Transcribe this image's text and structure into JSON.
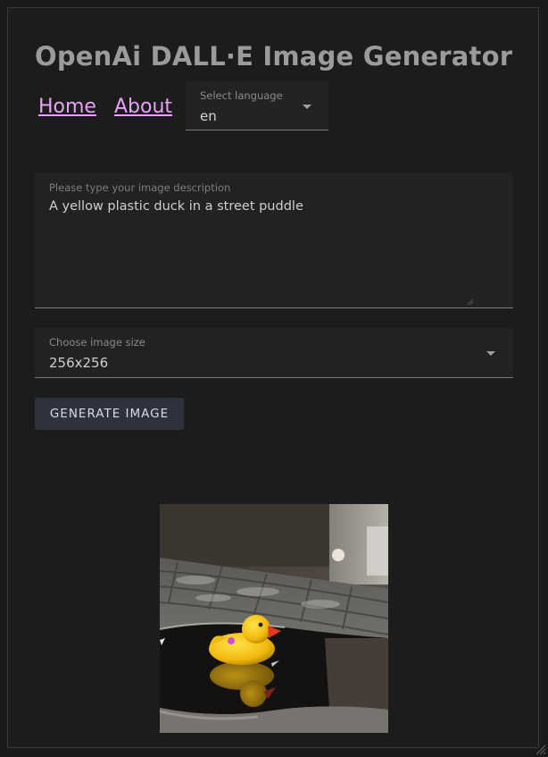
{
  "header": {
    "title": "OpenAi DALL·E Image Generator"
  },
  "nav": {
    "home": "Home",
    "about": "About"
  },
  "language": {
    "label": "Select language",
    "value": "en"
  },
  "prompt": {
    "label": "Please type your image description",
    "value": "A yellow plastic duck in a street puddle"
  },
  "size": {
    "label": "Choose image size",
    "value": "256x256"
  },
  "actions": {
    "generate_label": "GENERATE IMAGE"
  },
  "result": {
    "alt": "yellow plastic duck in a street puddle"
  },
  "colors": {
    "link": "#e6a3f5",
    "button": "#2e323d",
    "background": "#1c1c1c"
  }
}
